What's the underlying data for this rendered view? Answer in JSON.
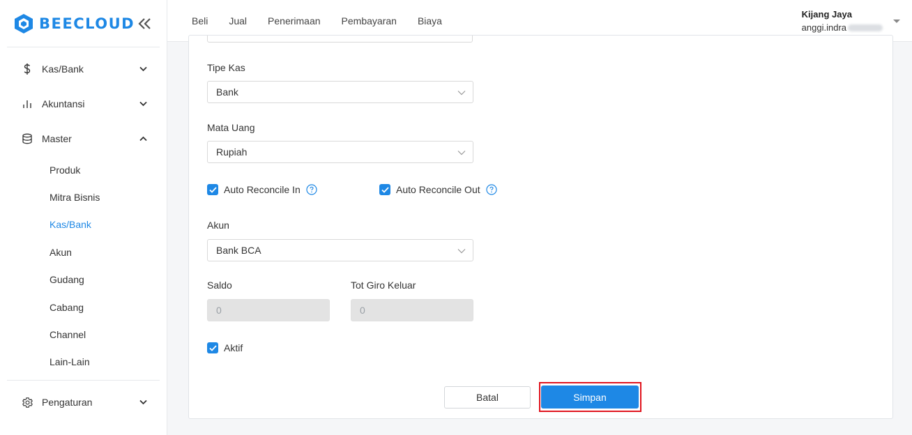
{
  "brand": {
    "name": "BEECLOUD",
    "color": "#1e88e5"
  },
  "sidebar": {
    "groups": [
      {
        "label": "Kas/Bank",
        "icon": "dollar-icon",
        "expanded": false
      },
      {
        "label": "Akuntansi",
        "icon": "bar-chart-icon",
        "expanded": false
      },
      {
        "label": "Master",
        "icon": "database-icon",
        "expanded": true,
        "items": [
          {
            "label": "Produk"
          },
          {
            "label": "Mitra Bisnis"
          },
          {
            "label": "Kas/Bank",
            "active": true
          },
          {
            "label": "Akun"
          },
          {
            "label": "Gudang"
          },
          {
            "label": "Cabang"
          },
          {
            "label": "Channel"
          },
          {
            "label": "Lain-Lain"
          }
        ]
      },
      {
        "label": "Pengaturan",
        "icon": "gear-icon",
        "expanded": false
      }
    ]
  },
  "header": {
    "menu": [
      "Beli",
      "Jual",
      "Penerimaan",
      "Pembayaran",
      "Biaya"
    ],
    "company": "Kijang Jaya",
    "email": "anggi.indra"
  },
  "form": {
    "tipe_kas": {
      "label": "Tipe Kas",
      "value": "Bank"
    },
    "mata_uang": {
      "label": "Mata Uang",
      "value": "Rupiah"
    },
    "auto_reconcile_in": {
      "label": "Auto Reconcile In",
      "checked": true
    },
    "auto_reconcile_out": {
      "label": "Auto Reconcile Out",
      "checked": true
    },
    "akun": {
      "label": "Akun",
      "value": "Bank BCA"
    },
    "saldo": {
      "label": "Saldo",
      "value": "0"
    },
    "tot_giro_keluar": {
      "label": "Tot Giro Keluar",
      "value": "0"
    },
    "aktif": {
      "label": "Aktif",
      "checked": true
    }
  },
  "actions": {
    "cancel": "Batal",
    "save": "Simpan"
  },
  "colors": {
    "accent": "#1e88e5",
    "highlight": "#e0141e"
  }
}
